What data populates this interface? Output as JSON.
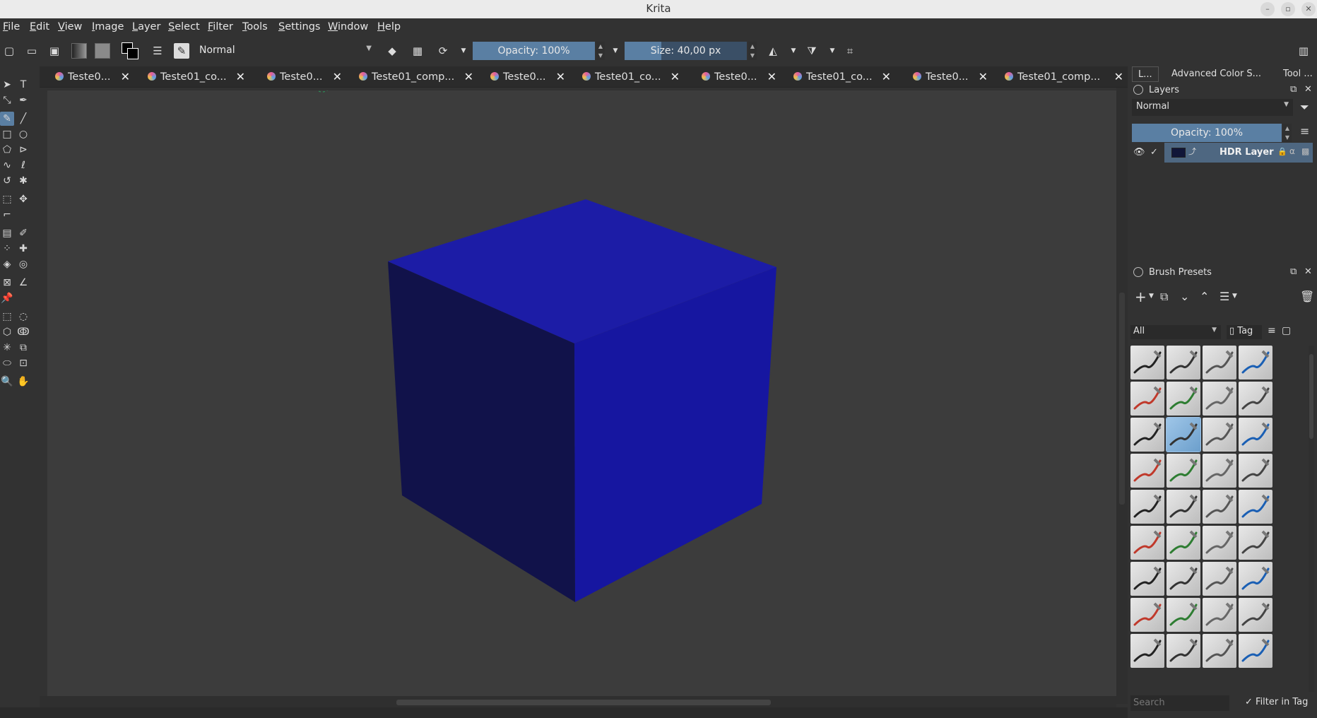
{
  "window": {
    "title": "Krita",
    "controls": {
      "minimize": "–",
      "maximize": "▫",
      "close": "✕"
    }
  },
  "menubar": {
    "items": [
      "File",
      "Edit",
      "View",
      "Image",
      "Layer",
      "Select",
      "Filter",
      "Tools",
      "Settings",
      "Window",
      "Help"
    ]
  },
  "toolbar": {
    "blend_mode": "Normal",
    "opacity": "Opacity: 100%",
    "opacity_level": 1.0,
    "size": "Size: 40,00 px",
    "size_level": 0.3
  },
  "tabs": [
    {
      "label": "Teste0..."
    },
    {
      "label": "Teste01_co..."
    },
    {
      "label": "Teste0..."
    },
    {
      "label": "Teste01_comp..."
    },
    {
      "label": "Teste0..."
    },
    {
      "label": "Teste01_co..."
    },
    {
      "label": "Teste0..."
    },
    {
      "label": "Teste01_co..."
    },
    {
      "label": "Teste0..."
    },
    {
      "label": "Teste01_comp..."
    }
  ],
  "dock": {
    "tabs": [
      "L...",
      "Advanced Color S...",
      "Tool ..."
    ],
    "layers": {
      "title": "Layers",
      "blend_mode": "Normal",
      "opacity": "Opacity: 100%",
      "opacity_level": 1.0,
      "rows": [
        {
          "name": "HDR Layer",
          "visible": true,
          "checked": true
        }
      ]
    },
    "brush_presets": {
      "title": "Brush Presets",
      "filter": "All",
      "tag_label": "Tag",
      "search_placeholder": "Search",
      "filter_in_tag": "Filter in Tag",
      "selected_index": 9
    }
  },
  "colors": {
    "accent": "#5a7fa3",
    "cube_top": "#1c1ca6",
    "cube_left": "#11124a",
    "cube_right": "#1616a0"
  }
}
